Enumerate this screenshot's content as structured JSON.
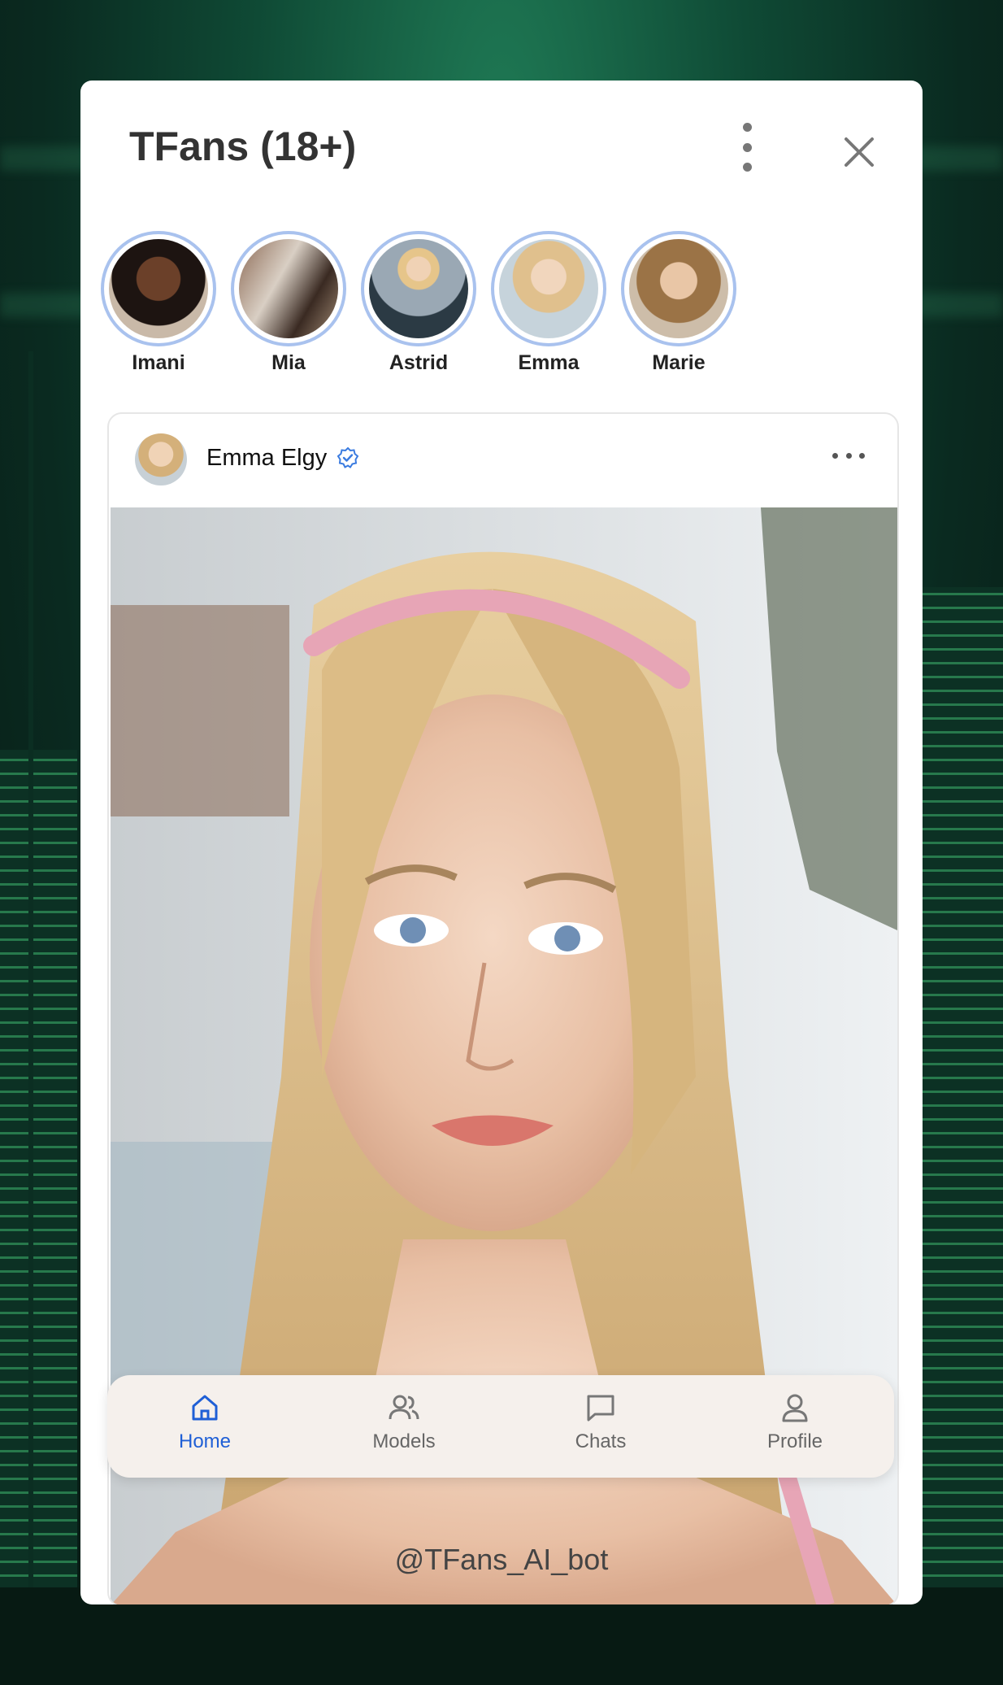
{
  "app": {
    "title": "TFans (18+)"
  },
  "stories": [
    {
      "name": "Imani"
    },
    {
      "name": "Mia"
    },
    {
      "name": "Astrid"
    },
    {
      "name": "Emma"
    },
    {
      "name": "Marie"
    }
  ],
  "post": {
    "author": "Emma Elgy"
  },
  "tabs": [
    {
      "label": "Home",
      "icon": "home-icon"
    },
    {
      "label": "Models",
      "icon": "users-icon"
    },
    {
      "label": "Chats",
      "icon": "chat-icon"
    },
    {
      "label": "Profile",
      "icon": "user-icon"
    }
  ],
  "footer": {
    "handle": "@TFans_AI_bot"
  },
  "colors": {
    "accent": "#1f5fd6",
    "story_ring": "#a9c2ee",
    "background": "#0f4a35"
  }
}
